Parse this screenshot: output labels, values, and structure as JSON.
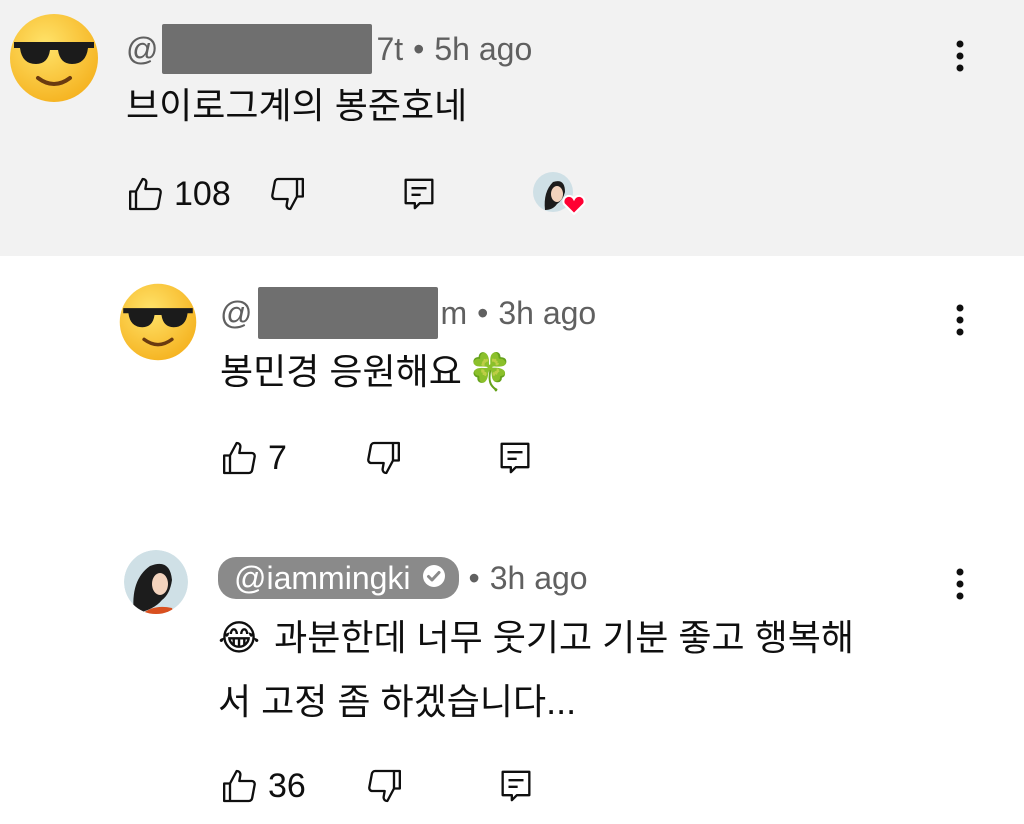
{
  "comments": [
    {
      "handle_prefix": "@",
      "handle_suffix": "7t",
      "separator": "•",
      "time": "5h ago",
      "text": "브이로그계의 봉준호네",
      "likes": "108",
      "creator_hearted": true
    },
    {
      "handle_prefix": "@",
      "handle_suffix": "m",
      "separator": "•",
      "time": "3h ago",
      "text": "봉민경 응원해요",
      "text_emoji": "🍀",
      "likes": "7"
    },
    {
      "handle": "@iammingki",
      "verified": true,
      "separator": "•",
      "time": "3h ago",
      "text_emoji": "😂",
      "text_line1": "과분한데 너무 웃기고 기분 좋고 행복해",
      "text_line2": "서 고정 좀 하겠습니다...",
      "likes": "36"
    }
  ],
  "icons": {
    "like": "thumbs-up-icon",
    "dislike": "thumbs-down-icon",
    "reply": "reply-icon",
    "menu": "more-vert-icon",
    "heart": "heart-icon"
  },
  "colors": {
    "highlight_bg": "#f2f2f2",
    "meta_text": "#606060",
    "heart": "#ff0033",
    "pill_bg": "#8a8a8a"
  }
}
